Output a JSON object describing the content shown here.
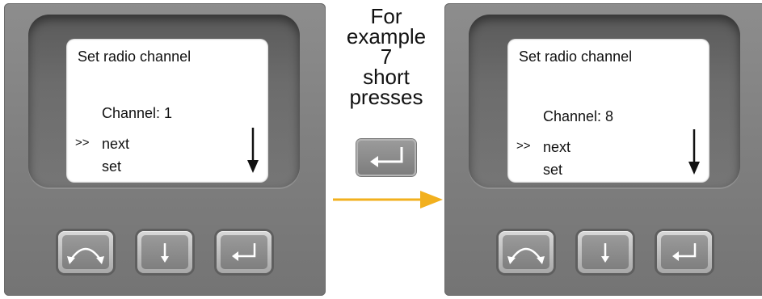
{
  "left_device": {
    "screen": {
      "title": "Set radio channel",
      "channel": "Channel: 1",
      "indicator": ">>",
      "next": "next",
      "set": "set"
    }
  },
  "right_device": {
    "screen": {
      "title": "Set radio channel",
      "channel": "Channel: 8",
      "indicator": ">>",
      "next": "next",
      "set": "set"
    }
  },
  "caption": {
    "line1": "For",
    "line2": "example",
    "line3": "7",
    "line4": "short",
    "line5": "presses"
  },
  "colors": {
    "flow_arrow": "#f2b01e",
    "device_body": "#808080",
    "screen": "#ffffff"
  },
  "icons": [
    "rotate-arrows-icon",
    "down-arrow-icon",
    "enter-icon",
    "scroll-down-arrow-icon",
    "flow-arrow-icon"
  ]
}
